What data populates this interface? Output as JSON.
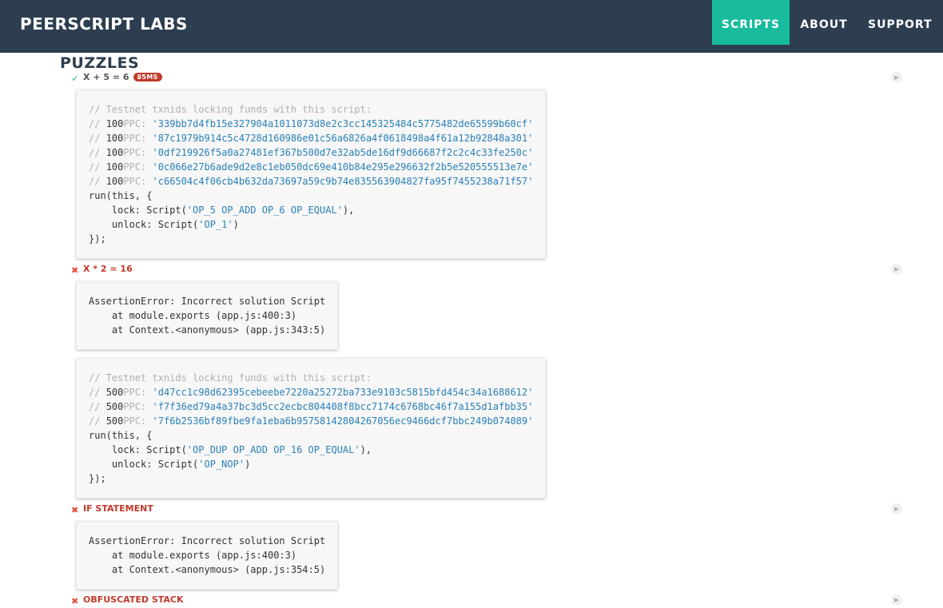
{
  "header": {
    "brand": "PEERSCRIPT LABS",
    "nav": [
      "SCRIPTS",
      "ABOUT",
      "SUPPORT"
    ]
  },
  "section": {
    "title": "PUZZLES"
  },
  "tests": [
    {
      "status": "pass",
      "title": "X + 5 = 6",
      "duration": "85MS"
    },
    {
      "status": "fail",
      "title": "X * 2 = 16"
    },
    {
      "status": "fail",
      "title": "IF STATEMENT"
    },
    {
      "status": "fail",
      "title": "OBFUSCATED STACK"
    }
  ],
  "code_blocks": {
    "puzzle1": {
      "header": "// Testnet txnids locking funds with this script:",
      "txns": [
        {
          "amount": "100",
          "unit": "PPC:",
          "txid": "'339bb7d4fb15e327904a1011073d8e2c3cc145325484c5775482de65599b60cf'"
        },
        {
          "amount": "100",
          "unit": "PPC:",
          "txid": "'87c1979b914c5c4728d160986e01c56a6826a4f0618498a4f61a12b92848a301'"
        },
        {
          "amount": "100",
          "unit": "PPC:",
          "txid": "'0df219926f5a0a27481ef367b500d7e32ab5de16df9d66687f2c2c4c33fe250c'"
        },
        {
          "amount": "100",
          "unit": "PPC:",
          "txid": "'0c066e27b6ade9d2e8c1eb050dc69e410b84e295e296632f2b5e520555513e7e'"
        },
        {
          "amount": "100",
          "unit": "PPC:",
          "txid": "'c66504c4f06cb4b632da73697a59c9b74e835563904827fa95f7455238a71f57'"
        }
      ],
      "run": "run(this, {",
      "lock_prefix": "    lock: Script(",
      "lock_script": "'OP_5 OP_ADD OP_6 OP_EQUAL'",
      "lock_suffix": "),",
      "unlock_prefix": "    unlock: Script(",
      "unlock_script": "'OP_1'",
      "unlock_suffix": ")",
      "close": "});"
    },
    "error1": {
      "lines": [
        "AssertionError: Incorrect solution Script",
        "    at module.exports (app.js:400:3)",
        "    at Context.<anonymous> (app.js:343:5)"
      ]
    },
    "puzzle2": {
      "header": "// Testnet txnids locking funds with this script:",
      "txns": [
        {
          "amount": "500",
          "unit": "PPC:",
          "txid": "'d47cc1c98d62395cebeebe7220a25272ba733e9103c5815bfd454c34a1688612'"
        },
        {
          "amount": "500",
          "unit": "PPC:",
          "txid": "'f7f36ed79a4a37bc3d5cc2ecbc804408f8bcc7174c6768bc46f7a155d1afbb35'"
        },
        {
          "amount": "500",
          "unit": "PPC:",
          "txid": "'7f6b2536bf89fbe9fa1eba6b957581428042670 56ec9466dcf7bbc249b074089'"
        }
      ],
      "run": "run(this, {",
      "lock_prefix": "    lock: Script(",
      "lock_script": "'OP_DUP OP_ADD OP_16 OP_EQUAL'",
      "lock_suffix": "),",
      "unlock_prefix": "    unlock: Script(",
      "unlock_script": "'OP_NOP'",
      "unlock_suffix": ")",
      "close": "});"
    },
    "error2": {
      "lines": [
        "AssertionError: Incorrect solution Script",
        "    at module.exports (app.js:400:3)",
        "    at Context.<anonymous> (app.js:354:5)"
      ]
    }
  },
  "icons": {
    "pass": "check-icon",
    "fail": "cross-icon",
    "replay": "play-icon"
  },
  "colors": {
    "header_bg": "#2c3e50",
    "active_nav": "#18bc9c",
    "fail": "#c0392b",
    "string": "#2980b9"
  }
}
